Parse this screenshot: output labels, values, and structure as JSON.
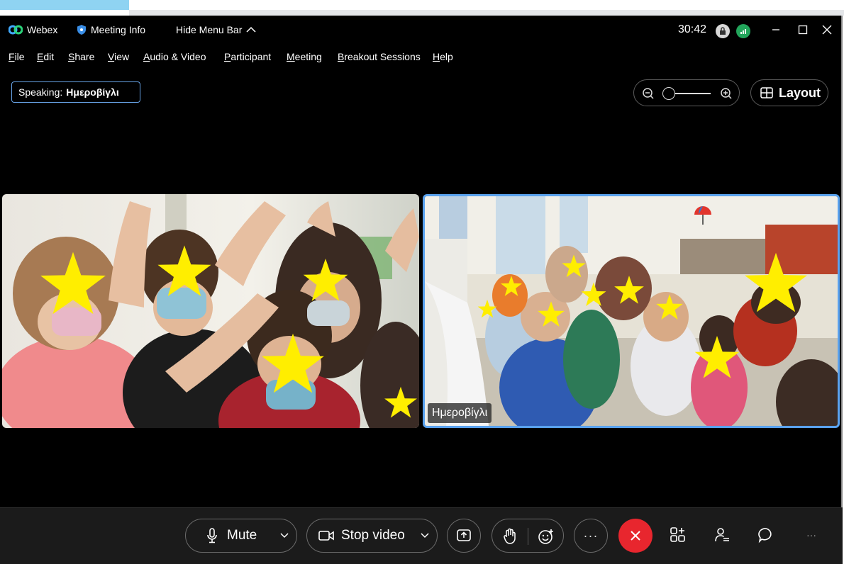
{
  "titlebar": {
    "app_name": "Webex",
    "meeting_info": "Meeting Info",
    "hide_menu_bar": "Hide Menu Bar",
    "timer": "30:42"
  },
  "menu": [
    "File",
    "Edit",
    "Share",
    "View",
    "Audio & Video",
    "Participant",
    "Meeting",
    "Breakout Sessions",
    "Help"
  ],
  "speaking": {
    "label": "Speaking:",
    "name": "Ημεροβίγλι"
  },
  "layout_label": "Layout",
  "video_tiles": [
    {
      "name": ""
    },
    {
      "name": "Ημεροβίγλι",
      "active_speaker": true
    }
  ],
  "toolbar": {
    "mute_label": "Mute",
    "stop_video_label": "Stop video",
    "more_label": "···",
    "overflow_label": "···"
  },
  "colors": {
    "accent_blue": "#5aa2ee",
    "leave_red": "#e8262e",
    "connection_green": "#22a55b",
    "star_yellow": "#ffee00",
    "background": "#000000"
  },
  "icons": [
    "webex-logo-icon",
    "shield-icon",
    "chevron-up-icon",
    "lock-icon",
    "signal-icon",
    "minimize-icon",
    "maximize-icon",
    "close-icon",
    "zoom-out-icon",
    "zoom-in-icon",
    "layout-icon",
    "microphone-icon",
    "chevron-down-icon",
    "camera-icon",
    "share-screen-icon",
    "raise-hand-icon",
    "reactions-icon",
    "leave-icon",
    "apps-icon",
    "participants-icon",
    "chat-icon"
  ]
}
